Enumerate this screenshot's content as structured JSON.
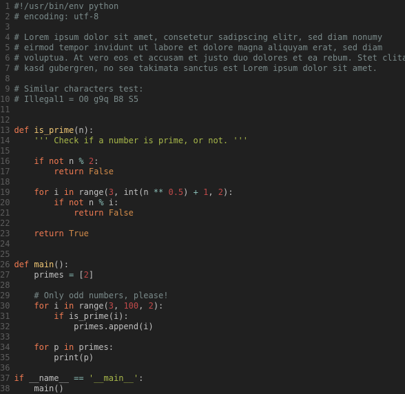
{
  "lines": [
    {
      "num": "1",
      "tokens": [
        [
          "cm",
          "#!/usr/bin/env python"
        ]
      ]
    },
    {
      "num": "2",
      "tokens": [
        [
          "cm",
          "# encoding: utf-8"
        ]
      ]
    },
    {
      "num": "3",
      "tokens": []
    },
    {
      "num": "4",
      "tokens": [
        [
          "cm",
          "# Lorem ipsum dolor sit amet, consetetur sadipscing elitr, sed diam nonumy"
        ]
      ]
    },
    {
      "num": "5",
      "tokens": [
        [
          "cm",
          "# eirmod tempor invidunt ut labore et dolore magna aliquyam erat, sed diam"
        ]
      ]
    },
    {
      "num": "6",
      "tokens": [
        [
          "cm",
          "# voluptua. At vero eos et accusam et justo duo dolores et ea rebum. Stet clita"
        ]
      ]
    },
    {
      "num": "7",
      "tokens": [
        [
          "cm",
          "# kasd gubergren, no sea takimata sanctus est Lorem ipsum dolor sit amet."
        ]
      ]
    },
    {
      "num": "8",
      "tokens": []
    },
    {
      "num": "9",
      "tokens": [
        [
          "cm",
          "# Similar characters test:"
        ]
      ]
    },
    {
      "num": "10",
      "tokens": [
        [
          "cm",
          "# Illegal1 = O0 g9q B8 S5"
        ]
      ]
    },
    {
      "num": "11",
      "tokens": []
    },
    {
      "num": "12",
      "tokens": []
    },
    {
      "num": "13",
      "tokens": [
        [
          "kw",
          "def"
        ],
        [
          "pl",
          " "
        ],
        [
          "fn",
          "is_prime"
        ],
        [
          "pl",
          "(n):"
        ]
      ]
    },
    {
      "num": "14",
      "tokens": [
        [
          "pl",
          "    "
        ],
        [
          "str",
          "''' Check if a number is prime, or not. '''"
        ]
      ]
    },
    {
      "num": "15",
      "tokens": []
    },
    {
      "num": "16",
      "tokens": [
        [
          "pl",
          "    "
        ],
        [
          "kw",
          "if"
        ],
        [
          "pl",
          " "
        ],
        [
          "kw",
          "not"
        ],
        [
          "pl",
          " n "
        ],
        [
          "op",
          "%"
        ],
        [
          "pl",
          " "
        ],
        [
          "num",
          "2"
        ],
        [
          "pl",
          ":"
        ]
      ]
    },
    {
      "num": "17",
      "tokens": [
        [
          "pl",
          "        "
        ],
        [
          "kw",
          "return"
        ],
        [
          "pl",
          " "
        ],
        [
          "bool",
          "False"
        ]
      ]
    },
    {
      "num": "18",
      "tokens": []
    },
    {
      "num": "19",
      "tokens": [
        [
          "pl",
          "    "
        ],
        [
          "kw",
          "for"
        ],
        [
          "pl",
          " i "
        ],
        [
          "kw",
          "in"
        ],
        [
          "pl",
          " range("
        ],
        [
          "num",
          "3"
        ],
        [
          "pl",
          ", int(n "
        ],
        [
          "op",
          "**"
        ],
        [
          "pl",
          " "
        ],
        [
          "num",
          "0.5"
        ],
        [
          "pl",
          ") "
        ],
        [
          "op",
          "+"
        ],
        [
          "pl",
          " "
        ],
        [
          "num",
          "1"
        ],
        [
          "pl",
          ", "
        ],
        [
          "num",
          "2"
        ],
        [
          "pl",
          "):"
        ]
      ]
    },
    {
      "num": "20",
      "tokens": [
        [
          "pl",
          "        "
        ],
        [
          "kw",
          "if"
        ],
        [
          "pl",
          " "
        ],
        [
          "kw",
          "not"
        ],
        [
          "pl",
          " n "
        ],
        [
          "op",
          "%"
        ],
        [
          "pl",
          " i:"
        ]
      ]
    },
    {
      "num": "21",
      "tokens": [
        [
          "pl",
          "            "
        ],
        [
          "kw",
          "return"
        ],
        [
          "pl",
          " "
        ],
        [
          "bool",
          "False"
        ]
      ]
    },
    {
      "num": "22",
      "tokens": []
    },
    {
      "num": "23",
      "tokens": [
        [
          "pl",
          "    "
        ],
        [
          "kw",
          "return"
        ],
        [
          "pl",
          " "
        ],
        [
          "bool",
          "True"
        ]
      ]
    },
    {
      "num": "24",
      "tokens": []
    },
    {
      "num": "25",
      "tokens": []
    },
    {
      "num": "26",
      "tokens": [
        [
          "kw",
          "def"
        ],
        [
          "pl",
          " "
        ],
        [
          "fn",
          "main"
        ],
        [
          "pl",
          "():"
        ]
      ]
    },
    {
      "num": "27",
      "tokens": [
        [
          "pl",
          "    primes "
        ],
        [
          "op",
          "="
        ],
        [
          "pl",
          " ["
        ],
        [
          "num",
          "2"
        ],
        [
          "pl",
          "]"
        ]
      ]
    },
    {
      "num": "28",
      "tokens": []
    },
    {
      "num": "29",
      "tokens": [
        [
          "pl",
          "    "
        ],
        [
          "cm",
          "# Only odd numbers, please!"
        ]
      ]
    },
    {
      "num": "30",
      "tokens": [
        [
          "pl",
          "    "
        ],
        [
          "kw",
          "for"
        ],
        [
          "pl",
          " i "
        ],
        [
          "kw",
          "in"
        ],
        [
          "pl",
          " range("
        ],
        [
          "num",
          "3"
        ],
        [
          "pl",
          ", "
        ],
        [
          "num",
          "100"
        ],
        [
          "pl",
          ", "
        ],
        [
          "num",
          "2"
        ],
        [
          "pl",
          "):"
        ]
      ]
    },
    {
      "num": "31",
      "tokens": [
        [
          "pl",
          "        "
        ],
        [
          "kw",
          "if"
        ],
        [
          "pl",
          " is_prime(i):"
        ]
      ]
    },
    {
      "num": "32",
      "tokens": [
        [
          "pl",
          "            primes.append(i)"
        ]
      ]
    },
    {
      "num": "33",
      "tokens": []
    },
    {
      "num": "34",
      "tokens": [
        [
          "pl",
          "    "
        ],
        [
          "kw",
          "for"
        ],
        [
          "pl",
          " p "
        ],
        [
          "kw",
          "in"
        ],
        [
          "pl",
          " primes:"
        ]
      ]
    },
    {
      "num": "35",
      "tokens": [
        [
          "pl",
          "        print(p)"
        ]
      ]
    },
    {
      "num": "36",
      "tokens": []
    },
    {
      "num": "37",
      "tokens": [
        [
          "kw",
          "if"
        ],
        [
          "pl",
          " __name__ "
        ],
        [
          "op",
          "=="
        ],
        [
          "pl",
          " "
        ],
        [
          "str",
          "'__main__'"
        ],
        [
          "pl",
          ":"
        ]
      ]
    },
    {
      "num": "38",
      "tokens": [
        [
          "pl",
          "    main()"
        ]
      ]
    }
  ]
}
